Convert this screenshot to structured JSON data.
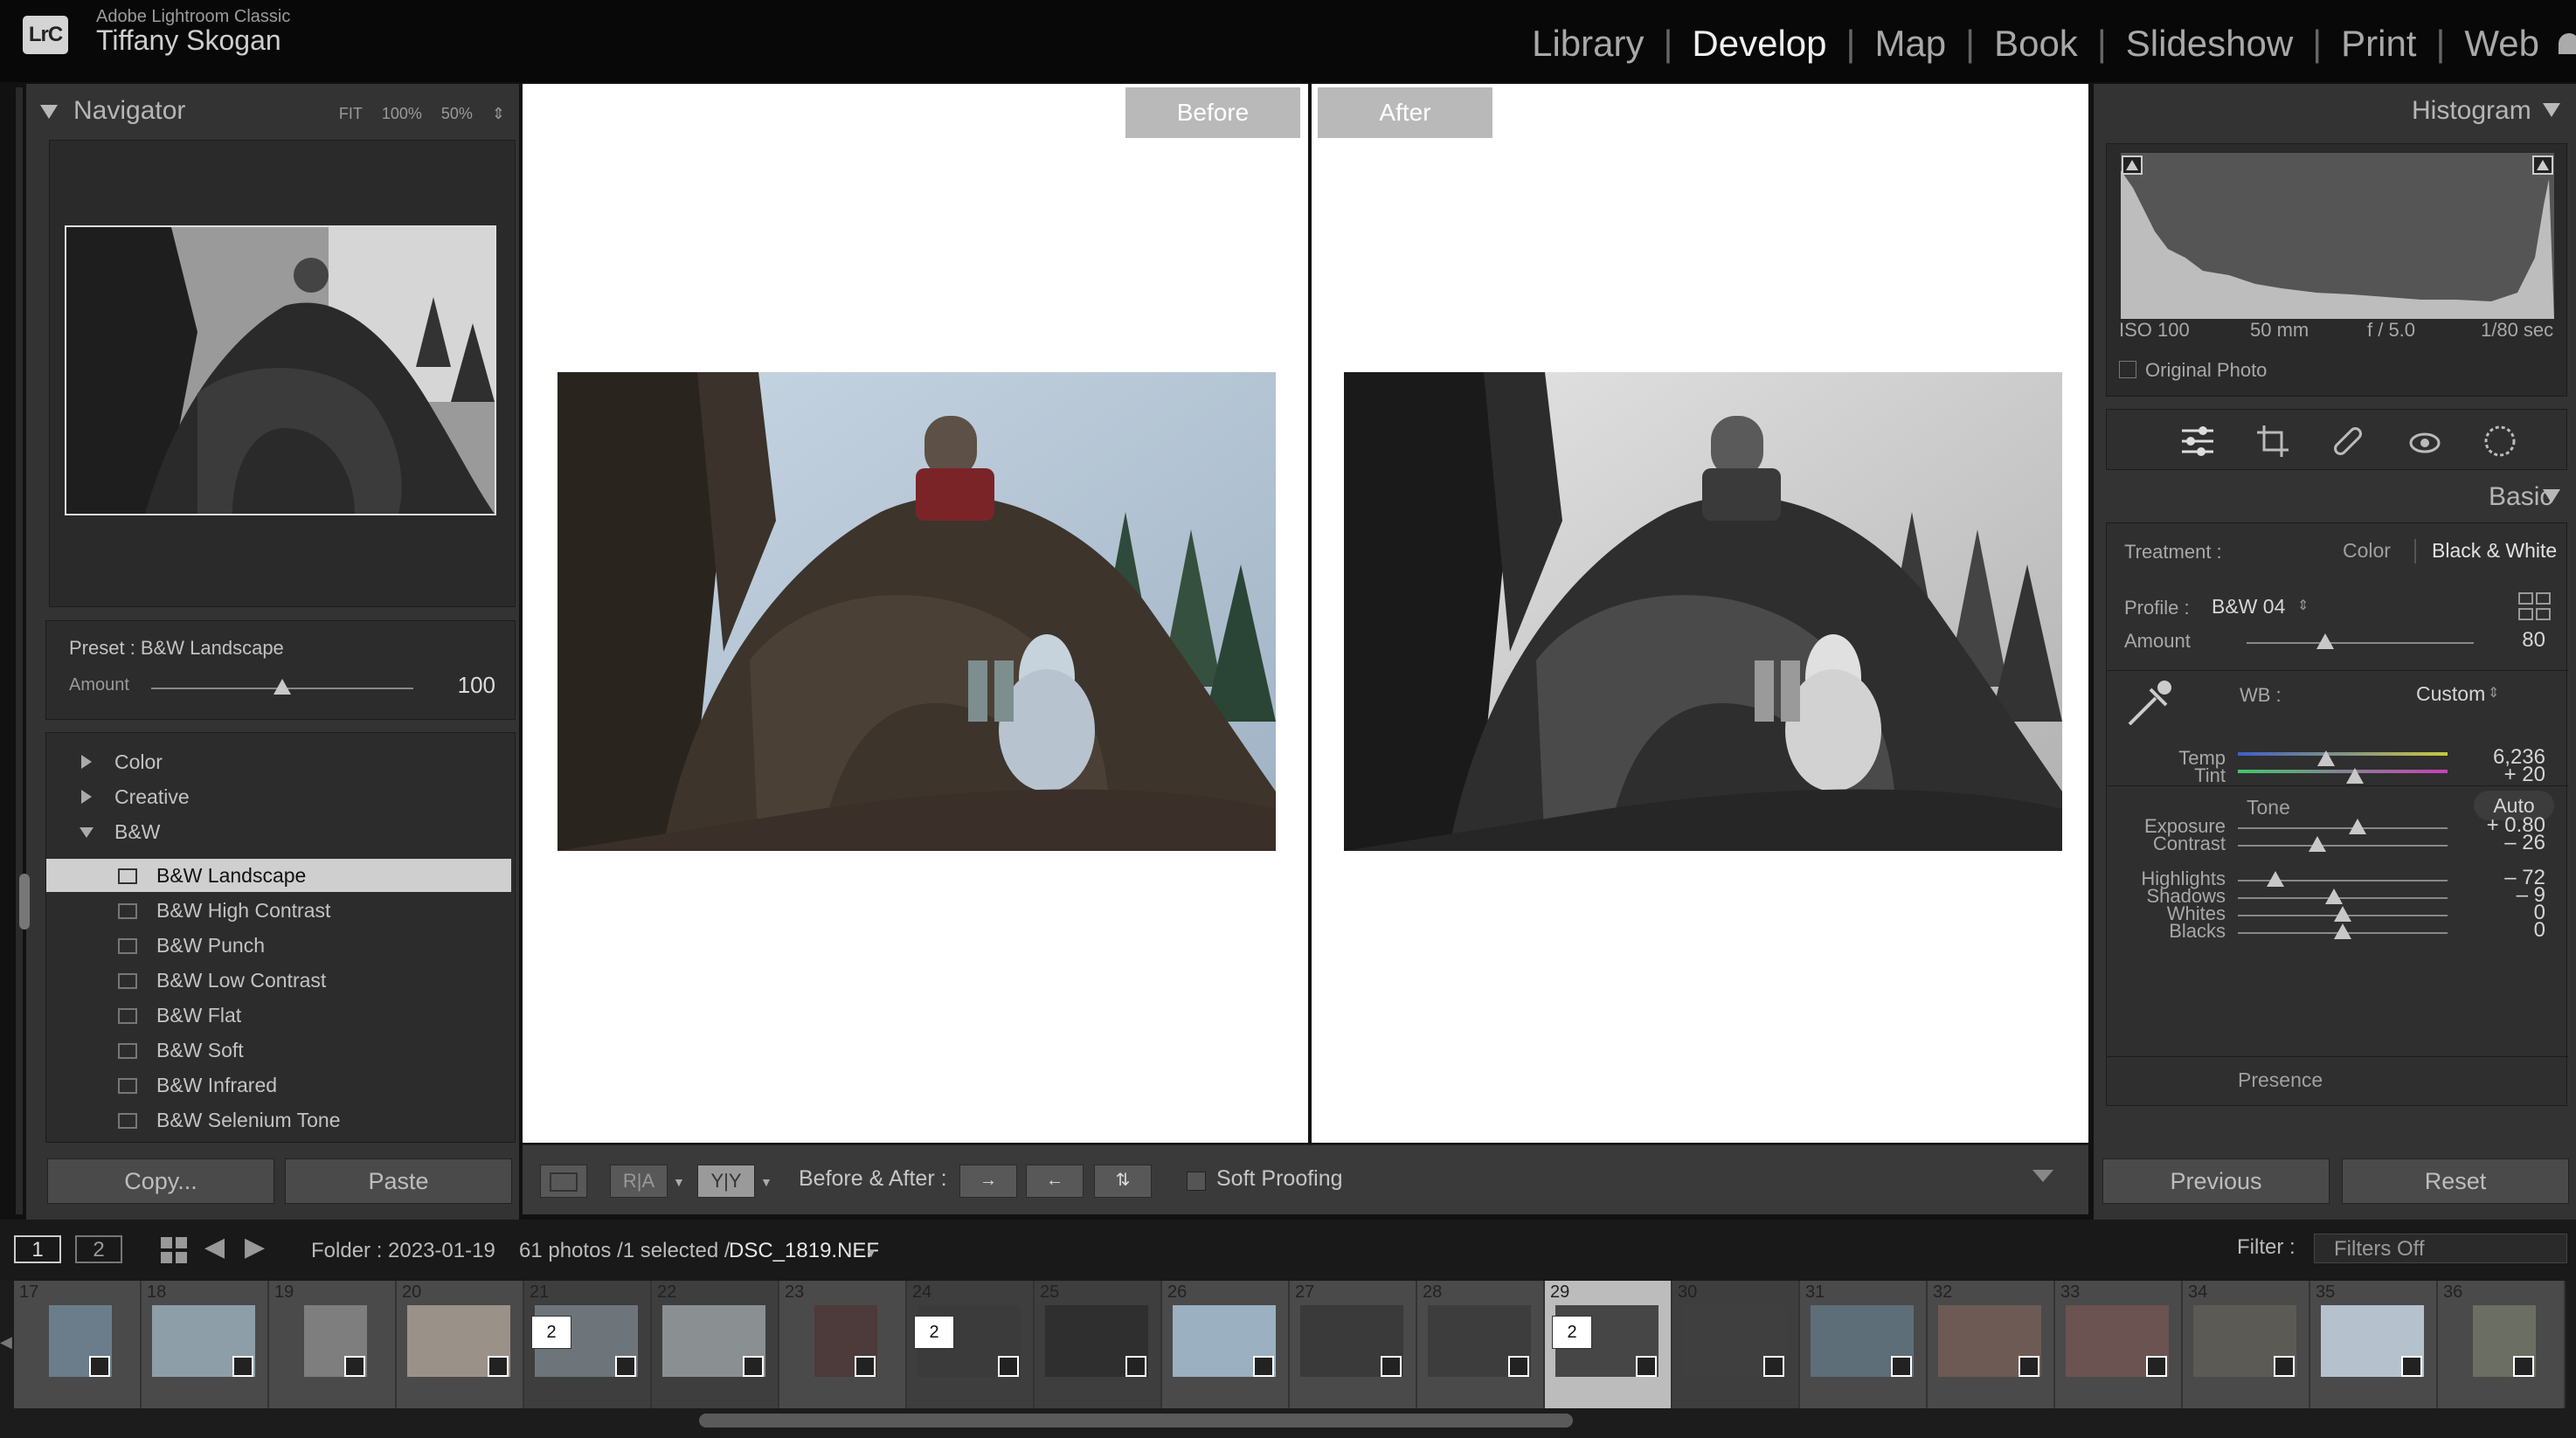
{
  "header": {
    "app_name": "Adobe Lightroom Classic",
    "logo_text": "LrC",
    "user_name": "Tiffany Skogan",
    "modules": [
      "Library",
      "Develop",
      "Map",
      "Book",
      "Slideshow",
      "Print",
      "Web"
    ],
    "active_module": "Develop"
  },
  "navigator": {
    "title": "Navigator",
    "zoom_options": [
      "FIT",
      "100%",
      "50%"
    ]
  },
  "preset_box": {
    "preset_label": "Preset : B&W Landscape",
    "amount_label": "Amount",
    "amount_value": "100",
    "amount_fraction": 0.5
  },
  "presets": {
    "groups": [
      "Color",
      "Creative",
      "B&W"
    ],
    "items": [
      "B&W Landscape",
      "B&W High Contrast",
      "B&W Punch",
      "B&W Low Contrast",
      "B&W Flat",
      "B&W Soft",
      "B&W Infrared",
      "B&W Selenium Tone"
    ],
    "selected": "B&W Landscape"
  },
  "left_buttons": {
    "copy": "Copy...",
    "paste": "Paste"
  },
  "view": {
    "before_label": "Before",
    "after_label": "After"
  },
  "toolbar": {
    "before_after_label": "Before & After :",
    "soft_proofing": "Soft Proofing"
  },
  "histogram": {
    "title": "Histogram",
    "iso": "ISO 100",
    "focal": "50 mm",
    "aperture": "f / 5.0",
    "shutter": "1/80 sec",
    "original_photo": "Original Photo"
  },
  "basic": {
    "title": "Basic",
    "treatment_label": "Treatment :",
    "treatment_color": "Color",
    "treatment_bw": "Black & White",
    "profile_label": "Profile :",
    "profile_value": "B&W 04",
    "amount_label": "Amount",
    "amount_value": "80",
    "wb_label": "WB :",
    "wb_value": "Custom",
    "tone_label": "Tone",
    "auto_label": "Auto",
    "presence_label": "Presence",
    "sliders": [
      {
        "label": "Temp",
        "value": "6,236",
        "pos": 0.42
      },
      {
        "label": "Tint",
        "value": "+ 20",
        "pos": 0.56
      },
      {
        "label": "Exposure",
        "value": "+ 0.80",
        "pos": 0.57
      },
      {
        "label": "Contrast",
        "value": "– 26",
        "pos": 0.38
      },
      {
        "label": "Highlights",
        "value": "– 72",
        "pos": 0.18
      },
      {
        "label": "Shadows",
        "value": "– 9",
        "pos": 0.46
      },
      {
        "label": "Whites",
        "value": "0",
        "pos": 0.5
      },
      {
        "label": "Blacks",
        "value": "0",
        "pos": 0.5
      }
    ]
  },
  "right_buttons": {
    "previous": "Previous",
    "reset": "Reset"
  },
  "filmstrip_bar": {
    "view1": "1",
    "view2": "2",
    "folder": "Folder : 2023-01-19",
    "count": "61 photos /1 selected /",
    "filename": "DSC_1819.NEF",
    "filter_label": "Filter :",
    "filter_value": "Filters Off"
  },
  "filmstrip": {
    "numbers": [
      "17",
      "18",
      "19",
      "20",
      "21",
      "22",
      "23",
      "24",
      "25",
      "26",
      "27",
      "28",
      "29",
      "30",
      "31",
      "32",
      "33",
      "34",
      "35",
      "36"
    ],
    "selected": "29",
    "stack_counts": {
      "21": "2",
      "24": "2",
      "29": "2"
    }
  },
  "colors": {
    "accent_panel": "#333333",
    "header_bg": "#080808",
    "selected_preset": "#cfcfcf"
  }
}
